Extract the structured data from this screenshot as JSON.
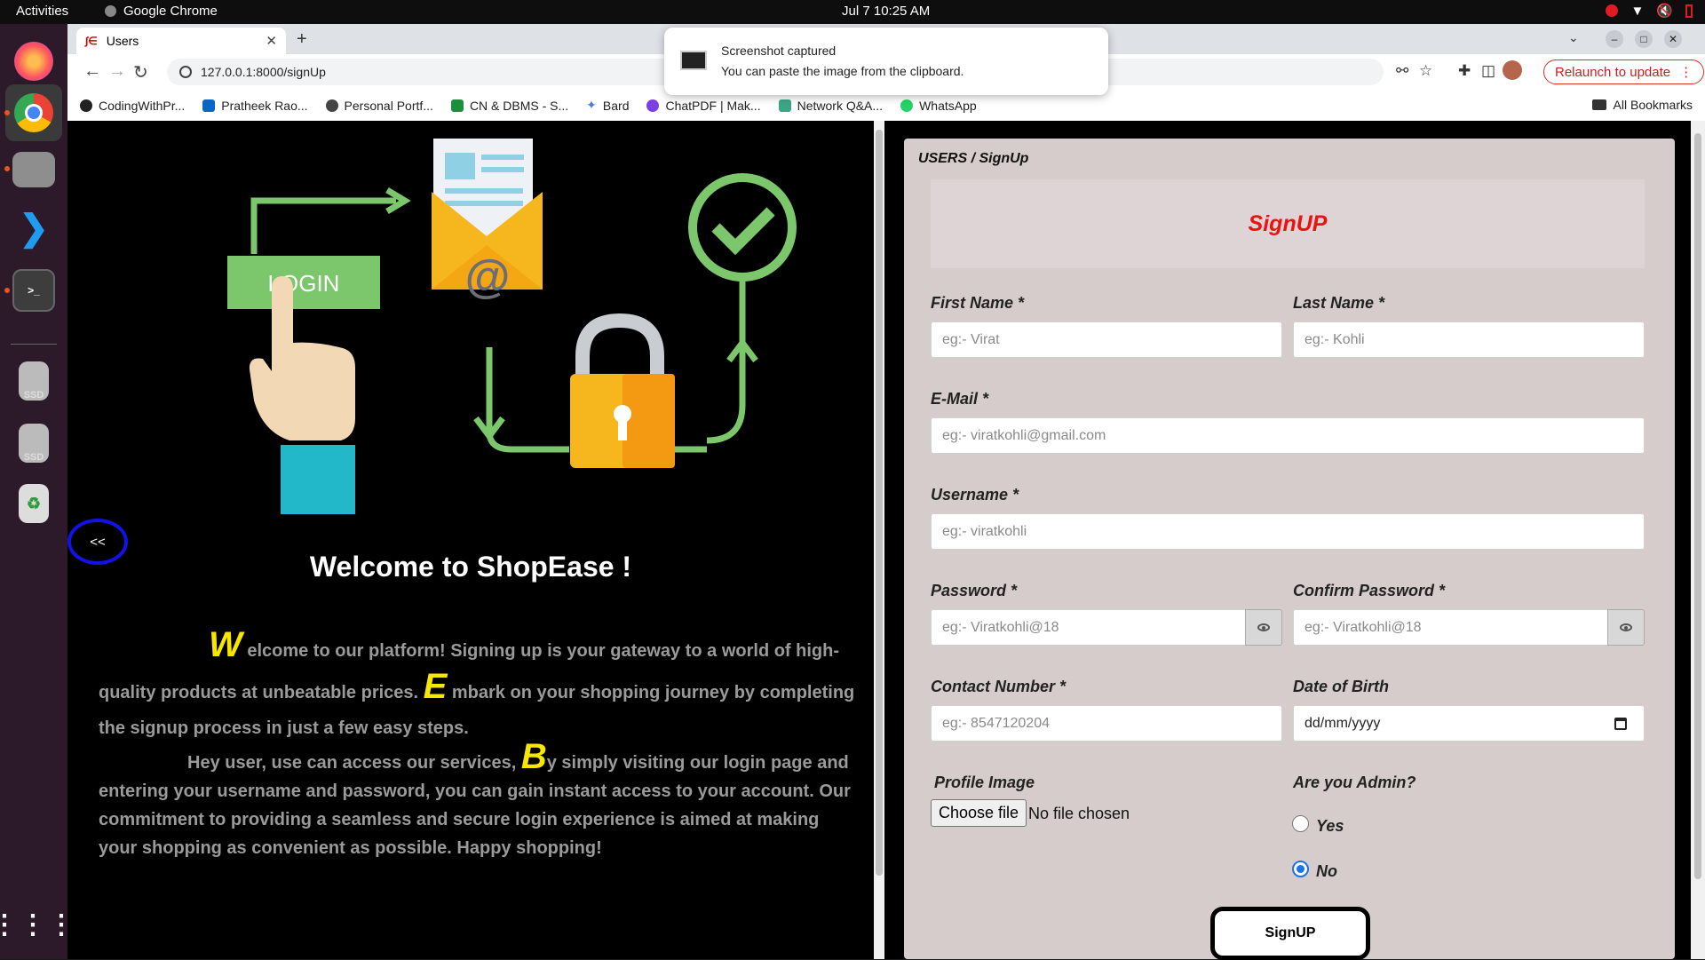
{
  "os": {
    "activities": "Activities",
    "app_name": "Google Chrome",
    "clock": "Jul 7  10:25 AM"
  },
  "browser": {
    "tab_title": "Users",
    "url": "127.0.0.1:8000/signUp",
    "relaunch_label": "Relaunch to update",
    "bookmarks": [
      "CodingWithPr...",
      "Pratheek Rao...",
      "Personal Portf...",
      "CN & DBMS - S...",
      "Bard",
      "ChatPDF | Mak...",
      "Network Q&A...",
      "WhatsApp"
    ],
    "all_bookmarks": "All Bookmarks"
  },
  "notification": {
    "title": "Screenshot captured",
    "body": "You can paste the image from the clipboard."
  },
  "hero": {
    "login_label": "LOGIN",
    "collapse_label": "<<",
    "welcome": "Welcome to ShopEase !",
    "p1_cap1": "W",
    "p1_text1": "elcome to our platform! Signing up is your gateway to a world of high-quality products at unbeatable prices.",
    "p1_cap2": "E",
    "p1_text2": "mbark on your shopping journey by completing the signup process in just a few easy steps.",
    "p2_text1": "Hey user, use can access our services,",
    "p2_cap": "B",
    "p2_text2": "y simply visiting our login page and entering your username and password, you can gain instant access to your account. Our commitment to providing a seamless and secure login experience is aimed at making your shopping as convenient as possible. Happy shopping!"
  },
  "form": {
    "breadcrumb": "USERS / SignUp",
    "title": "SignUP",
    "first_name_label": "First Name *",
    "first_name_placeholder": "eg:- Virat",
    "last_name_label": "Last Name *",
    "last_name_placeholder": "eg:- Kohli",
    "email_label": "E-Mail *",
    "email_placeholder": "eg:- viratkohli@gmail.com",
    "username_label": "Username *",
    "username_placeholder": "eg:- viratkohli",
    "password_label": "Password *",
    "password_placeholder": "eg:- Viratkohli@18",
    "confirm_label": "Confirm Password *",
    "confirm_placeholder": "eg:- Viratkohli@18",
    "contact_label": "Contact Number *",
    "contact_placeholder": "eg:- 8547120204",
    "dob_label": "Date of Birth",
    "dob_placeholder": "dd/mm/yyyy",
    "image_label": "Profile Image",
    "choose_file": "Choose file",
    "no_file": "No file chosen",
    "admin_label": "Are you Admin?",
    "yes_label": "Yes",
    "no_label": "No",
    "admin_selected": "No",
    "submit_label": "SignUP"
  }
}
